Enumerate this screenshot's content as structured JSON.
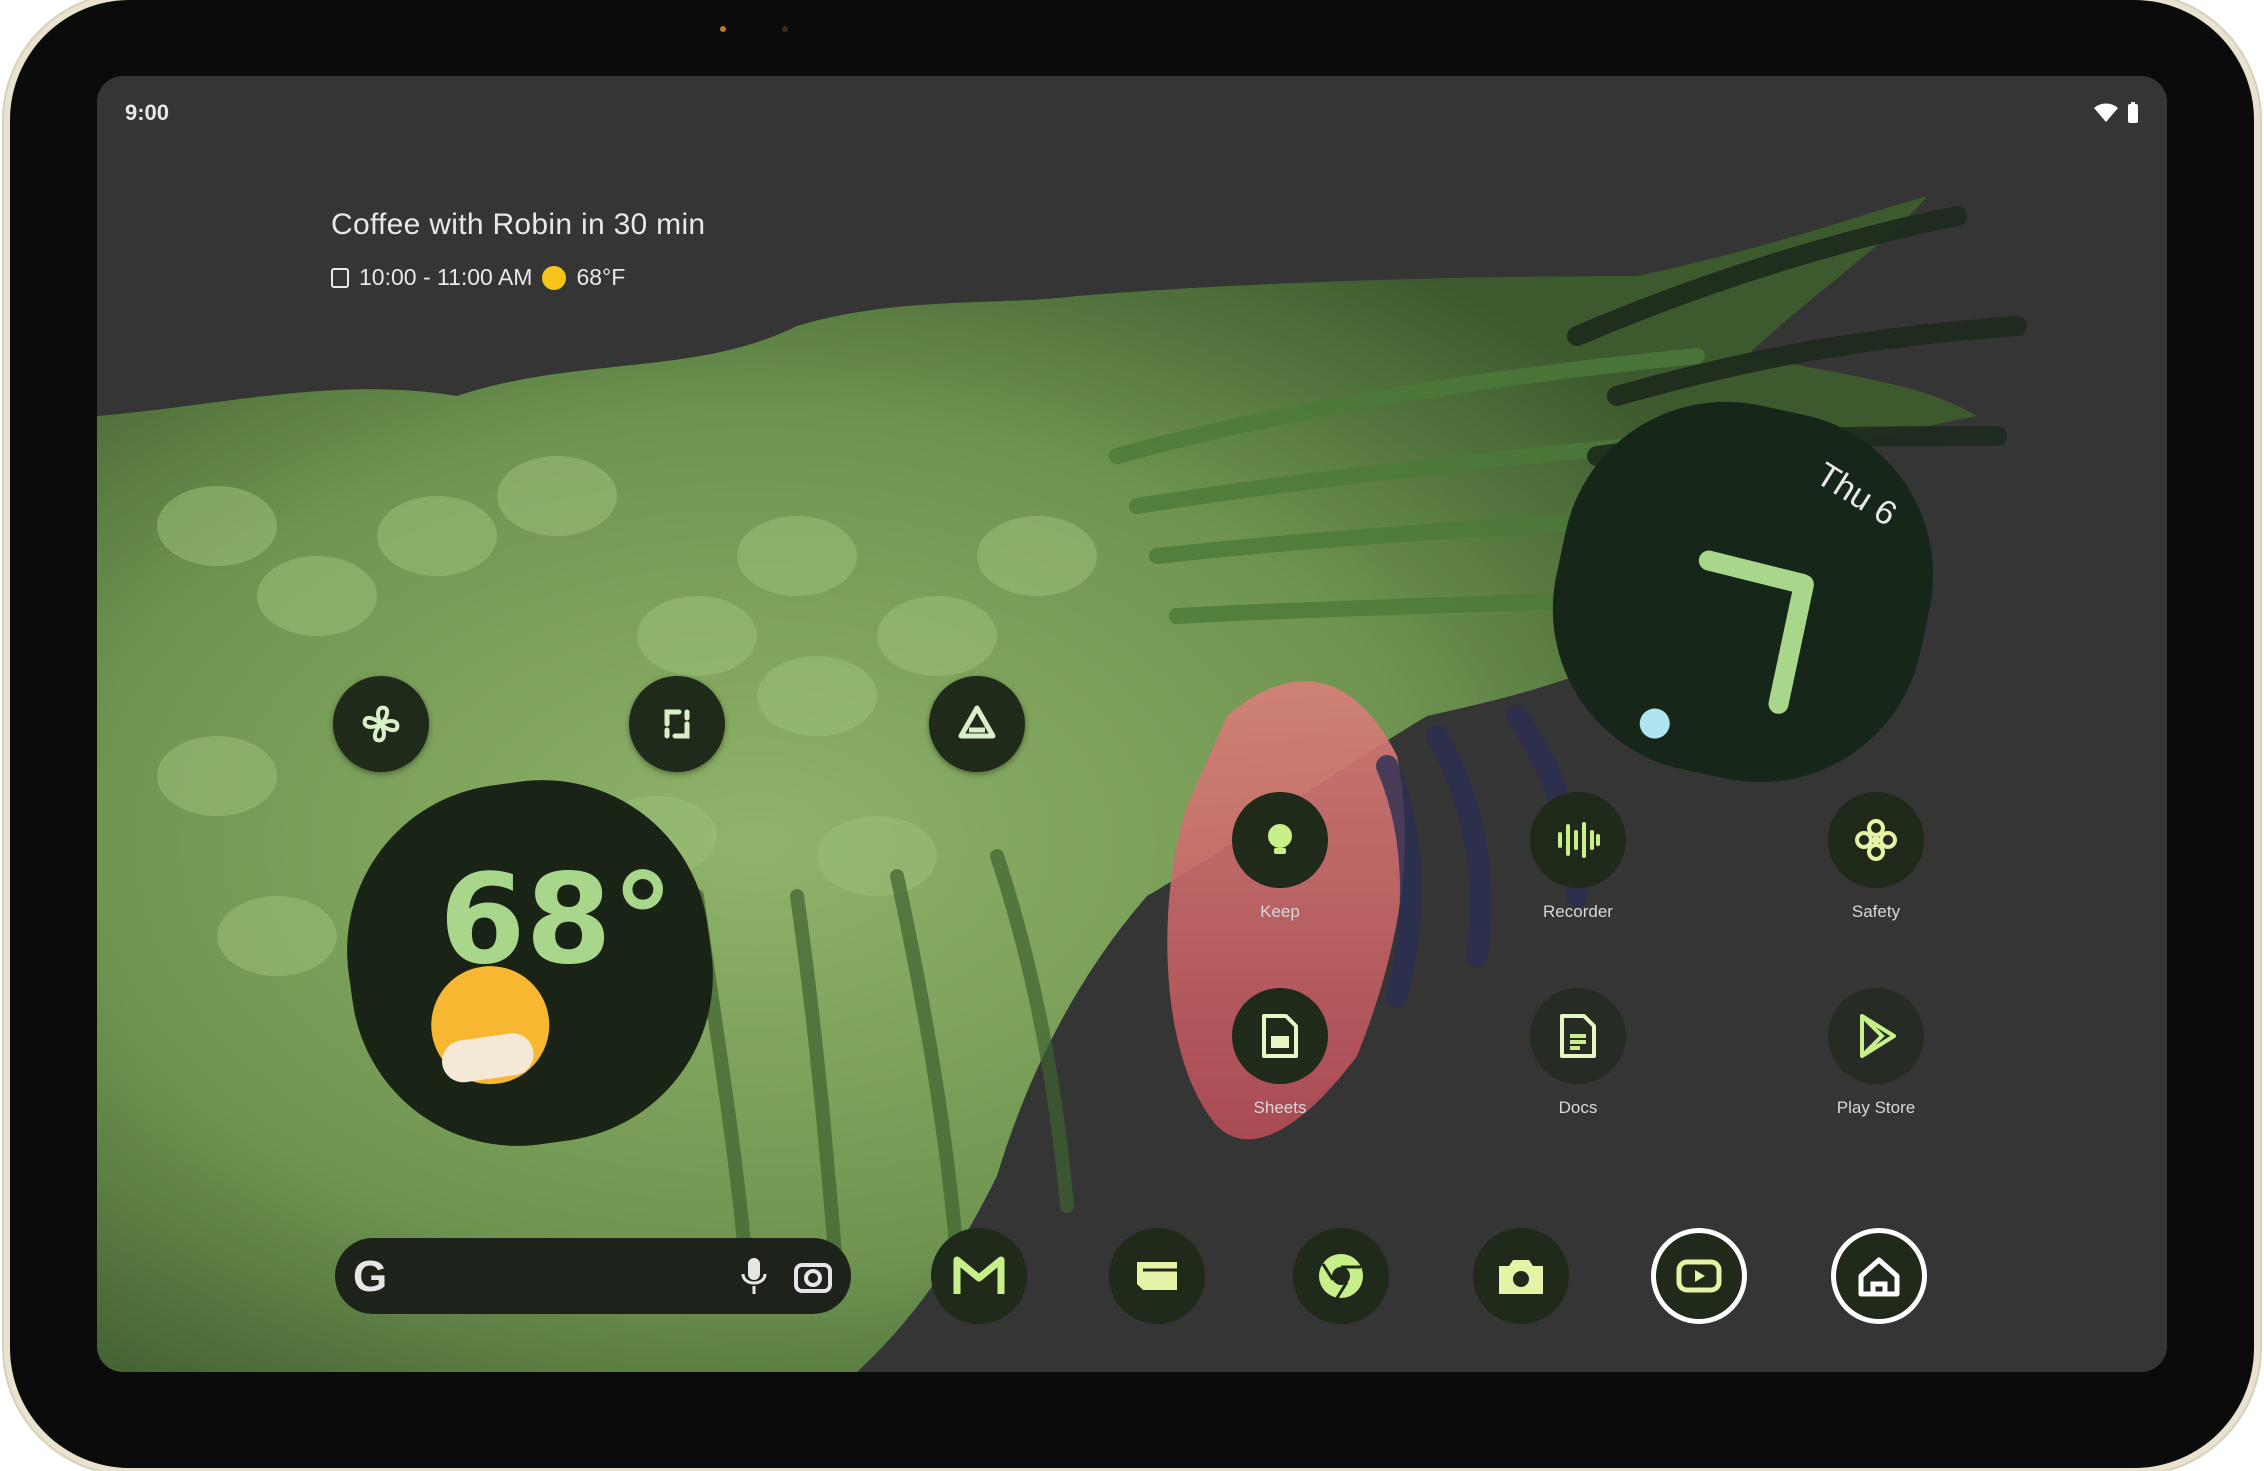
{
  "status_bar": {
    "time": "9:00",
    "wifi_icon": "wifi-icon",
    "battery_icon": "battery-icon"
  },
  "at_a_glance": {
    "event": "Coffee with Robin in 30 min",
    "time_range": "10:00 - 11:00 AM",
    "weather": "68°F"
  },
  "weather_widget": {
    "temperature": "68°",
    "condition_icon": "partly-sunny-icon"
  },
  "clock_widget": {
    "day": "Thu 6"
  },
  "quick_buttons": [
    {
      "icon": "fan-icon"
    },
    {
      "icon": "screenshot-icon"
    },
    {
      "icon": "drive-icon"
    }
  ],
  "apps": [
    {
      "label": "Keep",
      "icon": "keep-bulb-icon"
    },
    {
      "label": "Recorder",
      "icon": "recorder-wave-icon"
    },
    {
      "label": "Safety",
      "icon": "safety-flower-icon"
    },
    {
      "label": "Sheets",
      "icon": "sheets-icon"
    },
    {
      "label": "Docs",
      "icon": "docs-icon"
    },
    {
      "label": "Play Store",
      "icon": "play-store-icon"
    }
  ],
  "search_bar": {
    "logo": "G"
  },
  "dock": [
    {
      "icon": "gmail-icon"
    },
    {
      "icon": "files-icon"
    },
    {
      "icon": "chrome-icon"
    },
    {
      "icon": "camera-icon"
    },
    {
      "icon": "youtube-icon"
    },
    {
      "icon": "home-icon"
    }
  ],
  "colors": {
    "accent_green": "#a8d78c",
    "widget_dark": "#1f2a1b",
    "sun": "#f7b731"
  }
}
